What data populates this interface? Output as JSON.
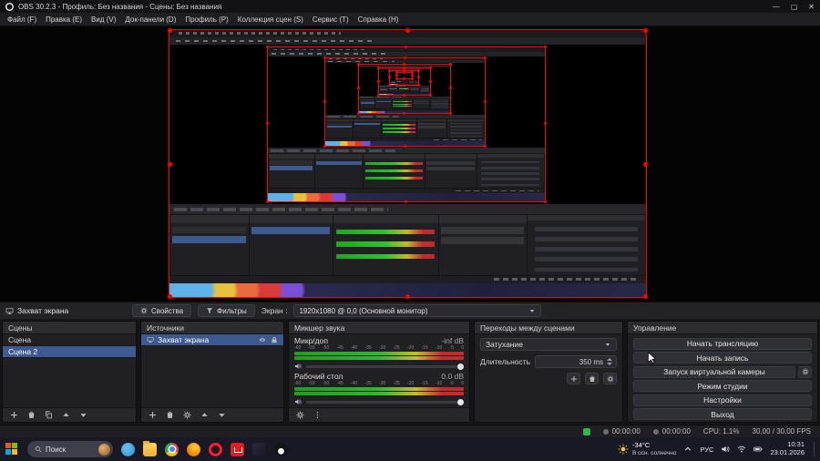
{
  "colors": {
    "selection_blue": "#3c5a8f",
    "capture_border_red": "#ff0000",
    "meter_green": "#2eb82e",
    "meter_yellow": "#c8bd27",
    "meter_red": "#c62b2b",
    "status_green": "#2db84d"
  },
  "title_bar": {
    "title": "OBS 30.2.3 - Профиль: Без названия - Сцены: Без названия",
    "minimize": "—",
    "maximize": "▢",
    "close": "✕"
  },
  "menu": {
    "items": [
      "Файл (F)",
      "Правка (E)",
      "Вид (V)",
      "Док-панели (D)",
      "Профиль (P)",
      "Коллекция сцен (S)",
      "Сервис (T)",
      "Справка (H)"
    ]
  },
  "source_toolbar": {
    "source_name": "Захват экрана",
    "properties_label": "Свойства",
    "filters_label": "Фильтры",
    "screen_label": "Экран :",
    "screen_value": "1920x1080 @ 0,0 (Основной монитор)"
  },
  "scenes_dock": {
    "title": "Сцены",
    "items": [
      {
        "label": "Сцена",
        "selected": false
      },
      {
        "label": "Сцена 2",
        "selected": true
      }
    ]
  },
  "sources_dock": {
    "title": "Источники",
    "items": [
      {
        "label": "Захват экрана",
        "selected": true
      }
    ]
  },
  "mixer_dock": {
    "title": "Микшер звука",
    "scale_ticks": [
      "-60",
      "-55",
      "-50",
      "-45",
      "-40",
      "-35",
      "-30",
      "-25",
      "-20",
      "-15",
      "-10",
      "-5",
      "0"
    ],
    "channels": [
      {
        "name": "Микр/доп",
        "db": "-inf dB",
        "volume_pct": 100
      },
      {
        "name": "Рабочий стол",
        "db": "0.0 dB",
        "volume_pct": 100
      }
    ]
  },
  "transitions_dock": {
    "title": "Переходы между сценами",
    "transition": "Затухание",
    "duration_label": "Длительность",
    "duration_value": "350 ms"
  },
  "controls_dock": {
    "title": "Управление",
    "buttons": {
      "stream": "Начать трансляцию",
      "record": "Начать запись",
      "virtual_cam": "Запуск виртуальной камеры",
      "studio_mode": "Режим студии",
      "settings": "Настройки",
      "exit": "Выход"
    }
  },
  "status_bar": {
    "stream_time": "00:00:00",
    "rec_time": "00:00:00",
    "cpu": "CPU: 1.1%",
    "fps": "30.00 / 30.00 FPS"
  },
  "taskbar": {
    "search_placeholder": "Поиск",
    "weather": {
      "temp": "-34°C",
      "condition": "В осн. солнечно"
    },
    "language": "РУС",
    "clock": {
      "time": "10:31",
      "date": "23.01.2026"
    }
  }
}
